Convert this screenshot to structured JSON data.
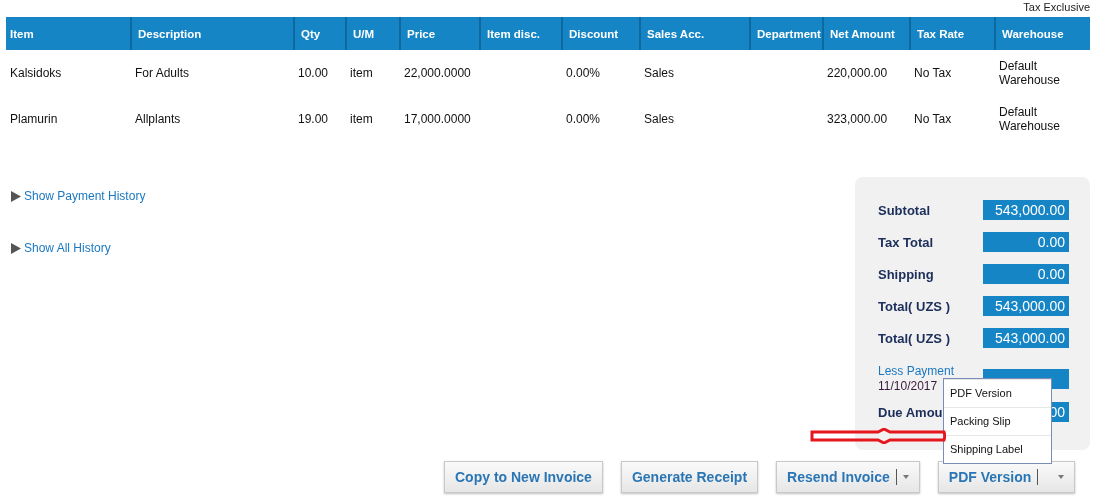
{
  "header_note": "Tax Exclusive",
  "table": {
    "columns": [
      "Item",
      "Description",
      "Qty",
      "U/M",
      "Price",
      "Item disc.",
      "Discount",
      "Sales Acc.",
      "Department",
      "Net Amount",
      "Tax Rate",
      "Warehouse"
    ],
    "rows": [
      {
        "cells": [
          "Kalsidoks",
          "For Adults",
          "10.00",
          "item",
          "22,000.0000",
          "",
          "0.00%",
          "Sales",
          "",
          "220,000.00",
          "No Tax",
          "Default Warehouse"
        ]
      },
      {
        "cells": [
          "Plamurin",
          "Allplants",
          "19.00",
          "item",
          "17,000.0000",
          "",
          "0.00%",
          "Sales",
          "",
          "323,000.00",
          "No Tax",
          "Default Warehouse"
        ]
      }
    ]
  },
  "history_links": [
    {
      "label": "Show Payment History",
      "expanded": false
    },
    {
      "label": "Show All History",
      "expanded": false
    }
  ],
  "totals": [
    {
      "kind": "row",
      "label": "Subtotal",
      "value": "543,000.00"
    },
    {
      "kind": "row",
      "label": "Tax Total",
      "value": "0.00"
    },
    {
      "kind": "row",
      "label": "Shipping",
      "value": "0.00"
    },
    {
      "kind": "row",
      "label": "Total( UZS )",
      "value": "543,000.00"
    },
    {
      "kind": "row",
      "label": "Total( UZS )",
      "value": "543,000.00"
    },
    {
      "kind": "payment",
      "label": "Less Payment",
      "date": "11/10/2017"
    },
    {
      "kind": "row",
      "label": "Due Amou",
      "value": "00"
    }
  ],
  "buttons": [
    {
      "label": "Copy to New Invoice",
      "has_caret": false
    },
    {
      "label": "Generate Receipt",
      "has_caret": false
    },
    {
      "label": "Resend Invoice",
      "has_caret": true
    },
    {
      "label": "PDF Version",
      "has_caret": true
    }
  ],
  "menu": {
    "items": [
      "PDF Version",
      "Packing Slip",
      "Shipping Label"
    ]
  }
}
